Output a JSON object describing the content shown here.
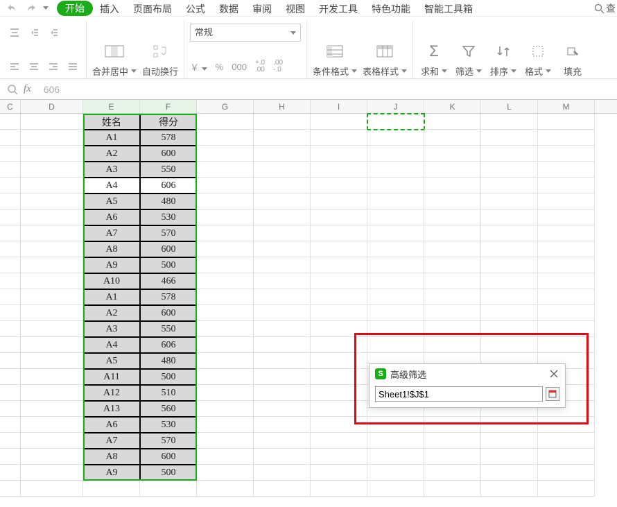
{
  "qat": {
    "caret": "▾"
  },
  "tabs": {
    "active": "开始",
    "items": [
      "开始",
      "插入",
      "页面布局",
      "公式",
      "数据",
      "审阅",
      "视图",
      "开发工具",
      "特色功能",
      "智能工具箱"
    ],
    "search_label": "查"
  },
  "toolbar": {
    "merge_center": "合并居中",
    "wrap_text": "自动换行",
    "number_format_selected": "常规",
    "currency_symbol": "￥",
    "percent": "%",
    "thousands": "000",
    "inc_dec": {
      "inc": "+.0",
      "dec": ".00",
      "inc2": ".00",
      "dec2": "-.0"
    },
    "cond_format": "条件格式",
    "table_style": "表格样式",
    "sum": "求和",
    "filter": "筛选",
    "sort": "排序",
    "format": "格式",
    "fill": "填充"
  },
  "formula": {
    "value": "606"
  },
  "columns": [
    "C",
    "D",
    "E",
    "F",
    "G",
    "H",
    "I",
    "J",
    "K",
    "L",
    "M"
  ],
  "table": {
    "header": {
      "name": "姓名",
      "score": "得分"
    },
    "rows": [
      {
        "name": "A1",
        "score": 578
      },
      {
        "name": "A2",
        "score": 600
      },
      {
        "name": "A3",
        "score": 550
      },
      {
        "name": "A4",
        "score": 606,
        "active": true
      },
      {
        "name": "A5",
        "score": 480
      },
      {
        "name": "A6",
        "score": 530
      },
      {
        "name": "A7",
        "score": 570
      },
      {
        "name": "A8",
        "score": 600
      },
      {
        "name": "A9",
        "score": 500
      },
      {
        "name": "A10",
        "score": 466
      },
      {
        "name": "A1",
        "score": 578
      },
      {
        "name": "A2",
        "score": 600
      },
      {
        "name": "A3",
        "score": 550
      },
      {
        "name": "A4",
        "score": 606
      },
      {
        "name": "A5",
        "score": 480
      },
      {
        "name": "A11",
        "score": 500
      },
      {
        "name": "A12",
        "score": 510
      },
      {
        "name": "A13",
        "score": 560
      },
      {
        "name": "A6",
        "score": 530
      },
      {
        "name": "A7",
        "score": 570
      },
      {
        "name": "A8",
        "score": 600
      },
      {
        "name": "A9",
        "score": 500
      }
    ]
  },
  "dialog": {
    "title": "高级筛选",
    "value": "Sheet1!$J$1"
  }
}
